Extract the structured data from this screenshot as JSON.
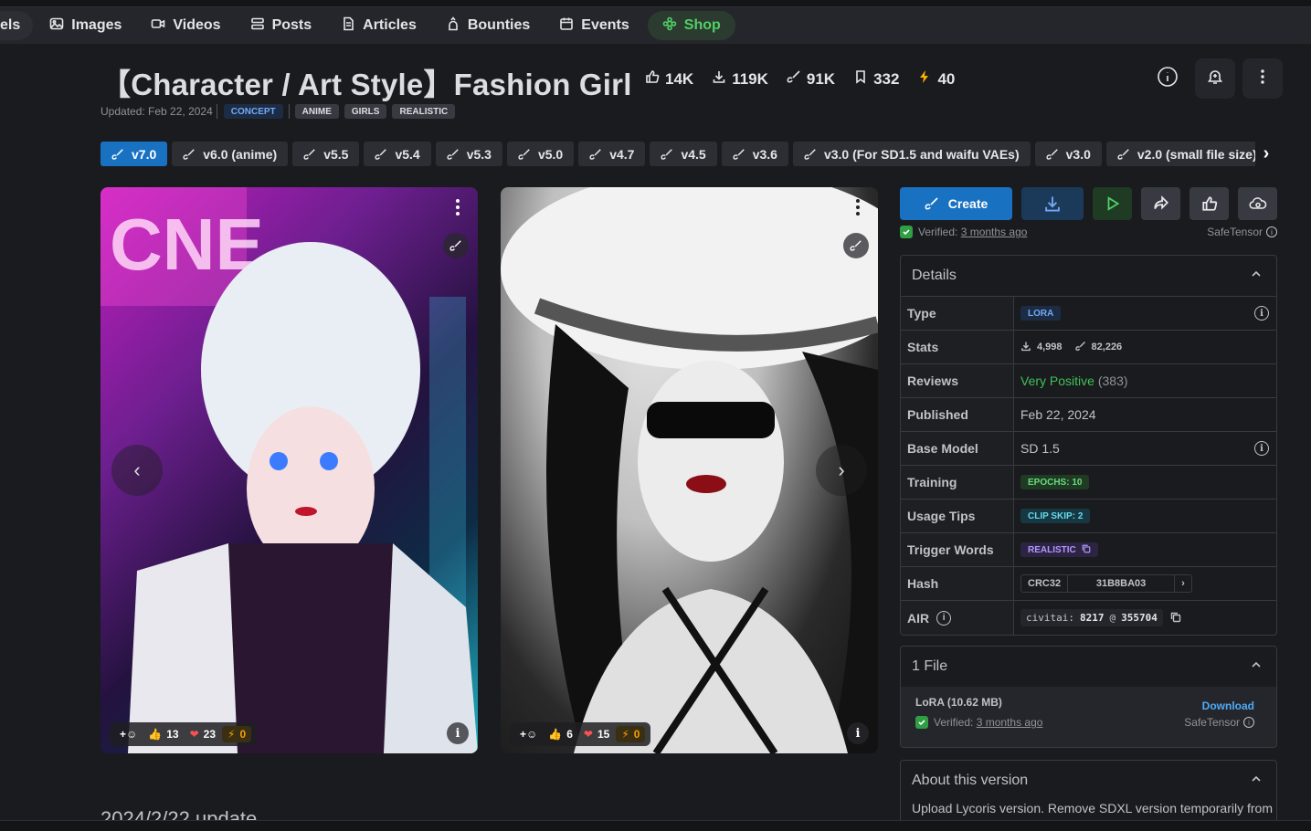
{
  "nav": {
    "items": [
      {
        "label": "els",
        "icon": "none"
      },
      {
        "label": "Images",
        "icon": "image-icon"
      },
      {
        "label": "Videos",
        "icon": "video-icon"
      },
      {
        "label": "Posts",
        "icon": "posts-icon"
      },
      {
        "label": "Articles",
        "icon": "article-icon"
      },
      {
        "label": "Bounties",
        "icon": "bounty-icon"
      },
      {
        "label": "Events",
        "icon": "calendar-icon"
      },
      {
        "label": "Shop",
        "icon": "shop-icon"
      }
    ]
  },
  "model": {
    "title": "【Character / Art Style】Fashion Girl",
    "stats": {
      "likes": "14K",
      "downloads": "119K",
      "generations": "91K",
      "collected": "332",
      "buzz": "40"
    },
    "updated": "Updated: Feb 22, 2024",
    "tags": [
      "CONCEPT",
      "ANIME",
      "GIRLS",
      "REALISTIC"
    ]
  },
  "versions": [
    "v7.0",
    "v6.0 (anime)",
    "v5.5",
    "v5.4",
    "v5.3",
    "v5.0",
    "v4.7",
    "v4.5",
    "v3.6",
    "v3.0 (For SD1.5 and waifu VAEs)",
    "v3.0",
    "v2.0 (small file size)",
    ""
  ],
  "gallery": [
    {
      "reactions": {
        "thumbs": "13",
        "hearts": "23",
        "buzz": "0"
      }
    },
    {
      "reactions": {
        "thumbs": "6",
        "hearts": "15",
        "buzz": "0"
      }
    }
  ],
  "actions": {
    "create_label": "Create",
    "verified_prefix": "Verified:",
    "verified_when": "3 months ago",
    "safetensor": "SafeTensor"
  },
  "details": {
    "heading": "Details",
    "type_label": "Type",
    "type_value": "LORA",
    "stats_label": "Stats",
    "stats_downloads": "4,998",
    "stats_generations": "82,226",
    "reviews_label": "Reviews",
    "reviews_value": "Very Positive",
    "reviews_count": "(383)",
    "published_label": "Published",
    "published_value": "Feb 22, 2024",
    "base_label": "Base Model",
    "base_value": "SD 1.5",
    "training_label": "Training",
    "training_value": "EPOCHS: 10",
    "usage_label": "Usage Tips",
    "usage_value": "CLIP SKIP: 2",
    "trigger_label": "Trigger Words",
    "trigger_value": "REALISTIC",
    "hash_label": "Hash",
    "hash_type": "CRC32",
    "hash_value": "31B8BA03",
    "air_label": "AIR",
    "air_prefix": "civitai:",
    "air_id": "8217",
    "air_at": "@",
    "air_version": "355704"
  },
  "files": {
    "heading": "1 File",
    "name": "LoRA (10.62 MB)",
    "download_label": "Download",
    "verified_prefix": "Verified:",
    "verified_when": "3 months ago",
    "safetensor": "SafeTensor"
  },
  "about": {
    "heading": "About this version",
    "text": "Upload Lycoris version. Remove SDXL version temporarily from"
  },
  "description": {
    "update_heading": "2024/2/22 update"
  }
}
